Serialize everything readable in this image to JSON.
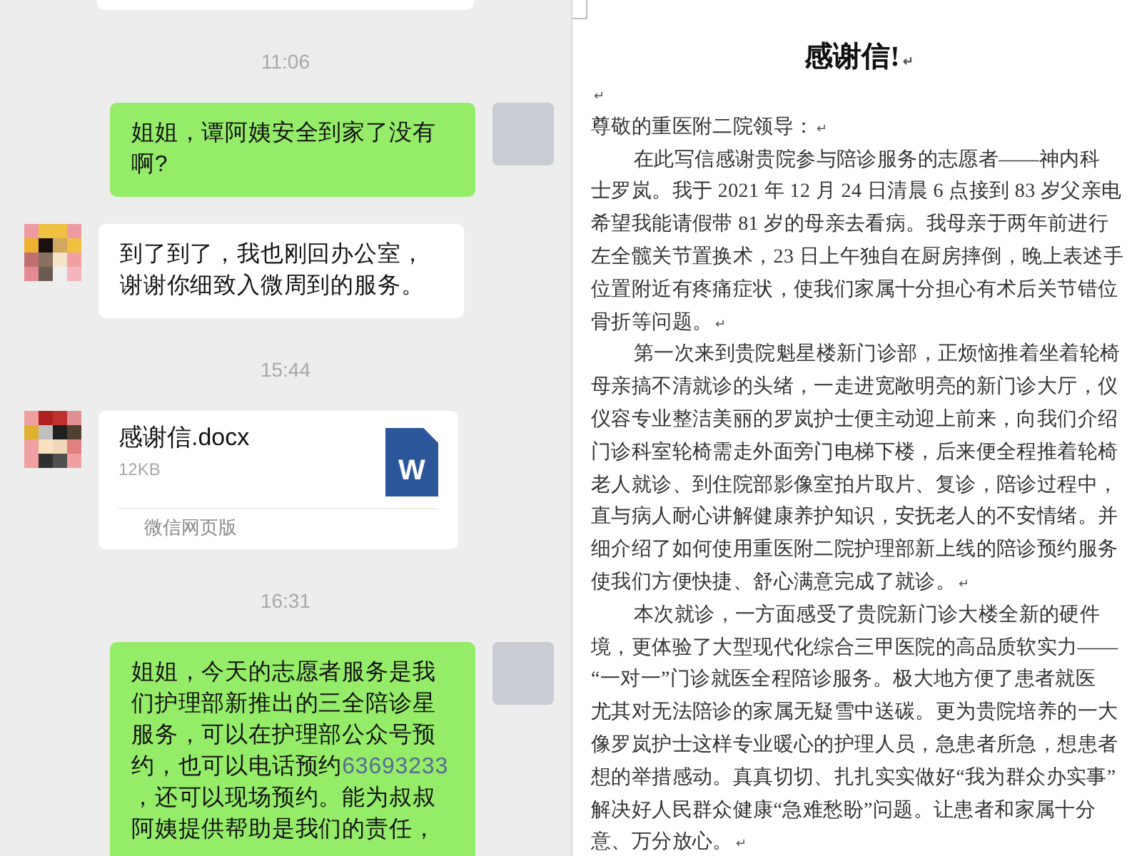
{
  "chat": {
    "items": [
      {
        "kind": "cut_bubble"
      },
      {
        "kind": "time",
        "text": "11:06"
      },
      {
        "kind": "message",
        "outgoing": true,
        "parts": [
          {
            "kind": "text",
            "text": "姐姐，谭阿姨安全到家了没有啊?"
          }
        ]
      },
      {
        "kind": "message",
        "outgoing": false,
        "parts": [
          {
            "kind": "text",
            "text": "到了到了，我也刚回办公室，谢谢你细致入微周到的服务。"
          }
        ]
      },
      {
        "kind": "time",
        "text": "15:44"
      },
      {
        "kind": "file",
        "name": "感谢信.docx",
        "size": "12KB",
        "icon_letter": "W",
        "source": "微信网页版"
      },
      {
        "kind": "time",
        "text": "16:31"
      },
      {
        "kind": "message",
        "outgoing": true,
        "parts": [
          {
            "kind": "text",
            "text": "姐姐，今天的志愿者服务是我们护理部新推出的三全陪诊星服务，可以在护理部公众号预约，也可以电话预约"
          },
          {
            "kind": "link",
            "text": "63693233"
          },
          {
            "kind": "text",
            "text": "，还可以现场预约。能为叔叔阿姨提供帮助是我们的责任，"
          }
        ]
      }
    ]
  },
  "document": {
    "title": "感谢信!",
    "title_mark": "↵",
    "lines": [
      {
        "mark": "↵",
        "indent": false
      },
      {
        "text": "尊敬的重医附二院领导：",
        "mark": "↵",
        "indent": false
      },
      {
        "text": "在此写信感谢贵院参与陪诊服务的志愿者——神内科",
        "indent": true
      },
      {
        "text": "士罗岚。我于 2021 年 12 月 24 日清晨 6 点接到 83 岁父亲电",
        "indent": false
      },
      {
        "text": "希望我能请假带 81 岁的母亲去看病。我母亲于两年前进行",
        "indent": false
      },
      {
        "text": "左全髋关节置换术，23 日上午独自在厨房摔倒，晚上表述手",
        "indent": false
      },
      {
        "text": "位置附近有疼痛症状，使我们家属十分担心有术后关节错位",
        "indent": false
      },
      {
        "text": "骨折等问题。",
        "mark": "↵",
        "indent": false
      },
      {
        "text": "第一次来到贵院魁星楼新门诊部，正烦恼推着坐着轮椅",
        "indent": true
      },
      {
        "text": "母亲搞不清就诊的头绪，一走进宽敞明亮的新门诊大厅，仪",
        "indent": false
      },
      {
        "text": "仪容专业整洁美丽的罗岚护士便主动迎上前来，向我们介绍",
        "indent": false
      },
      {
        "text": "门诊科室轮椅需走外面旁门电梯下楼，后来便全程推着轮椅",
        "indent": false
      },
      {
        "text": "老人就诊、到住院部影像室拍片取片、复诊，陪诊过程中，",
        "indent": false
      },
      {
        "text": "直与病人耐心讲解健康养护知识，安抚老人的不安情绪。并",
        "indent": false
      },
      {
        "text": "细介绍了如何使用重医附二院护理部新上线的陪诊预约服务",
        "indent": false
      },
      {
        "text": "使我们方便快捷、舒心满意完成了就诊。",
        "mark": "↵",
        "indent": false
      },
      {
        "text": "本次就诊，一方面感受了贵院新门诊大楼全新的硬件",
        "indent": true
      },
      {
        "text": "境，更体验了大型现代化综合三甲医院的高品质软实力——",
        "indent": false
      },
      {
        "text": "“一对一”门诊就医全程陪诊服务。极大地方便了患者就医",
        "indent": false
      },
      {
        "text": "尤其对无法陪诊的家属无疑雪中送碳。更为贵院培养的一大",
        "indent": false
      },
      {
        "text": "像罗岚护士这样专业暖心的护理人员，急患者所急，想患者",
        "indent": false
      },
      {
        "text": "想的举措感动。真真切切、扎扎实实做好“我为群众办实事”",
        "indent": false
      },
      {
        "text": "解决好人民群众健康“急难愁盼”问题。让患者和家属十分",
        "indent": false
      },
      {
        "text": "意、万分放心。",
        "mark": "↵",
        "indent": false
      }
    ]
  }
}
